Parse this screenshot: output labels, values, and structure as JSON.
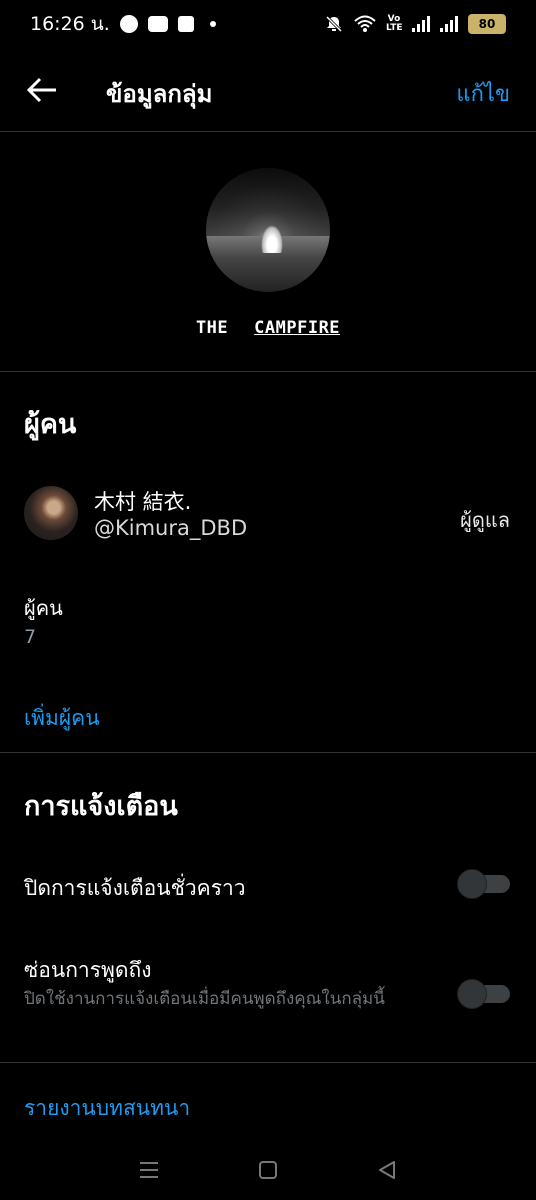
{
  "status_bar": {
    "time": "16:26 น.",
    "battery": "80",
    "volte": "Vo LTE",
    "app_icons": [
      "messenger-icon",
      "youtube-icon",
      "facebook-icon"
    ],
    "system_icons": [
      "mute-icon",
      "wifi-icon",
      "signal-icon",
      "battery-icon"
    ]
  },
  "header": {
    "title": "ข้อมูลกลุ่ม",
    "edit_label": "แก้ไข"
  },
  "group": {
    "name_part1": "THE",
    "name_part2": "CAMPFIRE"
  },
  "people_section": {
    "heading": "ผู้คน",
    "member": {
      "name": "木村 結衣.",
      "handle": "@Kimura_DBD",
      "role": "ผู้ดูแล"
    },
    "count_label": "ผู้คน",
    "count_value": "7",
    "add_people_label": "เพิ่มผู้คน"
  },
  "notifications_section": {
    "heading": "การแจ้งเตือน",
    "snooze_label": "ปิดการแจ้งเตือนชั่วคราว",
    "snooze_on": false,
    "mentions_label": "ซ่อนการพูดถึง",
    "mentions_sub": "ปิดใช้งานการแจ้งเตือนเมื่อมีคนพูดถึงคุณในกลุ่มนี้",
    "mentions_on": false
  },
  "report_label": "รายงานบทสนทนา",
  "colors": {
    "background": "#000000",
    "accent": "#1d9bf0",
    "divider": "#2f3336",
    "muted": "#71767b"
  }
}
